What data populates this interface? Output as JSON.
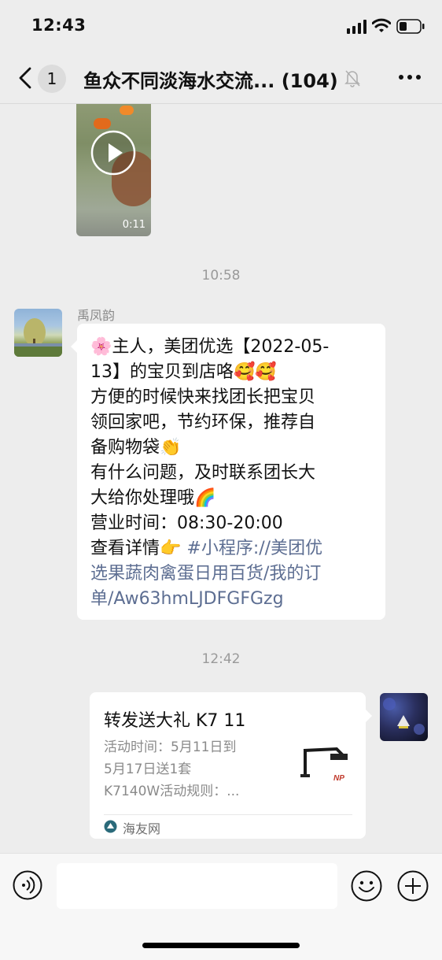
{
  "status_bar": {
    "time": "12:43"
  },
  "nav": {
    "unread_count": "1",
    "title": "鱼众不同淡海水交流... (104)"
  },
  "messages": {
    "video": {
      "duration": "0:11"
    },
    "time_1": "10:58",
    "sender_name": "禹凤韵",
    "text_lines": [
      "主人，美团优选【2022-05-",
      "13】的宝贝到店咯",
      "方便的时候快来找团长把宝贝",
      "领回家吧，节约环保，推荐自",
      "备购物袋",
      "有什么问题，及时联系团长大",
      "大给你处理哦",
      "营业时间：08:30-20:00",
      "查看详情",
      "#小程序://美团优",
      "选果蔬肉禽蛋日用百货/我的订",
      "单/Aw63hmLJDFGFGzg"
    ],
    "emojis": {
      "flower": "🌸",
      "smiling_hearts": "🥰",
      "clap": "👏",
      "rainbow": "🌈",
      "pointing_right": "👉"
    },
    "time_2": "12:42",
    "link_card": {
      "title": "转发送大礼 K7 11",
      "description_lines": [
        "活动时间：5月11日到",
        "5月17日送1套",
        "K7140W活动规则：..."
      ],
      "source": "海友网",
      "thumbnail_logo": "NP"
    }
  },
  "colors": {
    "background": "#ededed",
    "bubble": "#ffffff",
    "link_text": "#5d6e92",
    "timestamp": "#9a9a9a"
  },
  "icons": [
    "back-icon",
    "mute-icon",
    "more-icon",
    "play-icon",
    "voice-icon",
    "emoji-icon",
    "add-icon"
  ]
}
